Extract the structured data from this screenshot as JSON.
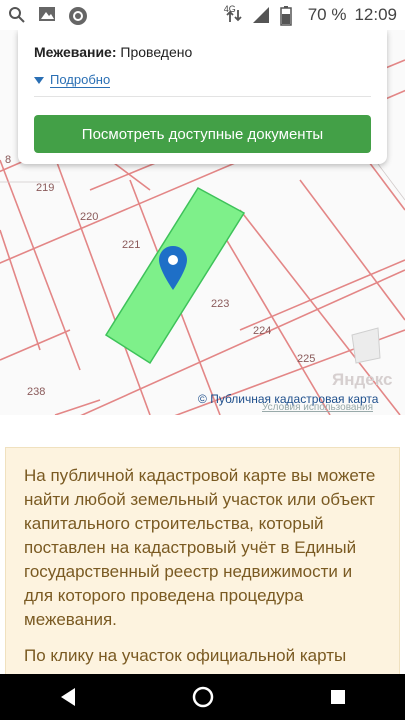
{
  "status_bar": {
    "network": "4G",
    "battery": "70 %",
    "time": "12:09",
    "icons": [
      "search-icon",
      "image-icon",
      "app-icon",
      "network-icon",
      "signal-icon",
      "battery-icon"
    ]
  },
  "card": {
    "survey_label": "Межевание:",
    "survey_value": "Проведено",
    "details_label": "Подробно",
    "docs_button": "Посмотреть доступные документы"
  },
  "map": {
    "parcel_labels": [
      "219",
      "220",
      "221",
      "223",
      "224",
      "225",
      "238",
      "8"
    ],
    "selected_parcel_color": "#7ef08a",
    "boundary_color": "#e06565",
    "pin_color": "#1e6fc7",
    "attribution": "Публичная кадастровая карта",
    "attribution_symbol": "©",
    "yandex_logo": "Яндекс",
    "yandex_terms": "Условия использования"
  },
  "info": {
    "paragraph1": "На публичной кадастровой карте вы можете найти любой земельный участок или объект капитального строительства, который поставлен на кадастровый учёт в Единый государственный реестр недвижимости и для которого проведена процедура межевания.",
    "paragraph2": "По клику на участок официальной карты"
  },
  "nav": {
    "back": "back-icon",
    "home": "home-icon",
    "recents": "recents-icon"
  }
}
